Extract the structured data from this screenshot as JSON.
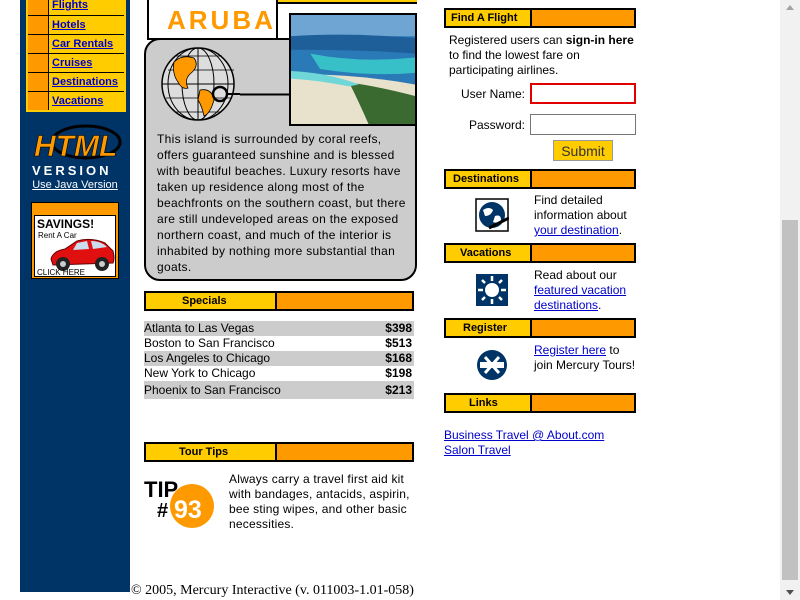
{
  "nav": {
    "items": [
      {
        "label": "Flights"
      },
      {
        "label": "Hotels"
      },
      {
        "label": "Car Rentals"
      },
      {
        "label": "Cruises"
      },
      {
        "label": "Destinations"
      },
      {
        "label": "Vacations"
      }
    ]
  },
  "logo": {
    "line1": "HTML",
    "line2": "VERSION",
    "java_link": "Use Java Version"
  },
  "ad": {
    "headline": "SAVINGS!",
    "sub": "Rent A Car",
    "cta": "CLICK HERE"
  },
  "feature": {
    "title": "ARUBA",
    "description": "This island is surrounded by coral reefs, offers guaranteed sunshine and is blessed with beautiful beaches. Luxury resorts have taken up residence along most of the beachfronts on the southern coast, but there are still undeveloped areas on the exposed northern coast, and much of the interior is inhabited by nothing more substantial than goats."
  },
  "specials": {
    "heading": "Specials",
    "rows": [
      {
        "route": "Atlanta to Las Vegas",
        "price": "$398"
      },
      {
        "route": "Boston to San Francisco",
        "price": "$513"
      },
      {
        "route": "Los Angeles to Chicago",
        "price": "$168"
      },
      {
        "route": "New York to Chicago",
        "price": "$198"
      },
      {
        "route": "Phoenix to San Francisco",
        "price": "$213"
      }
    ]
  },
  "tour_tips": {
    "heading": "Tour Tips",
    "badge_word": "TIP",
    "badge_hash": "#",
    "badge_number": "93",
    "text": "Always carry a travel first aid kit with bandages, antacids, aspirin, bee sting wipes, and other basic necessities."
  },
  "find_flight": {
    "heading": "Find A Flight",
    "intro_before": "Registered users can ",
    "intro_bold": "sign-in here",
    "intro_after": " to find the lowest fare on participating airlines.",
    "username_label": "User Name:",
    "username_value": "",
    "password_label": "Password:",
    "password_value": "",
    "submit_label": "Submit"
  },
  "destinations": {
    "heading": "Destinations",
    "text_before": "Find detailed information about ",
    "link": "your destination",
    "text_after": "."
  },
  "vacations": {
    "heading": "Vacations",
    "text_before": "Read about our ",
    "link": "featured vacation destinations",
    "text_after": "."
  },
  "register": {
    "heading": "Register",
    "link": "Register here",
    "text_after": " to join Mercury Tours!"
  },
  "links": {
    "heading": "Links",
    "items": [
      {
        "label": "Business Travel @ About.com"
      },
      {
        "label": "Salon Travel"
      }
    ]
  },
  "footer": {
    "text": "© 2005, Mercury Interactive (v. 011003-1.01-058)"
  },
  "colors": {
    "navy": "#003366",
    "orange": "#ff9900",
    "yellow": "#ffcc00",
    "panel_gray": "#cccccc"
  }
}
